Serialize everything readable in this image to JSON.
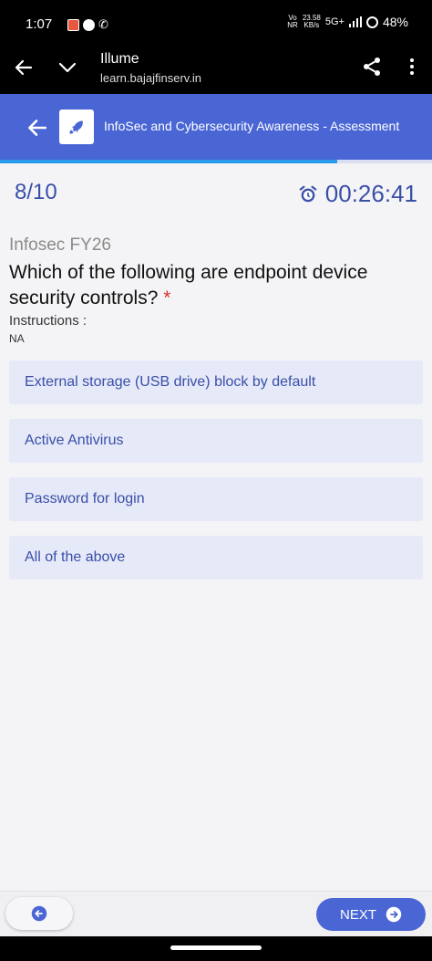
{
  "status": {
    "time": "1:07",
    "network_small_top": "Vo",
    "network_small_bottom": "NR",
    "speed_value": "23.58",
    "speed_unit": "KB/s",
    "network": "5G+",
    "battery": "48%"
  },
  "browser": {
    "title": "Illume",
    "url": "learn.bajajfinserv.in"
  },
  "app": {
    "title": "InfoSec and Cybersecurity Awareness - Assessment"
  },
  "progress": {
    "fraction": 0.78
  },
  "quiz": {
    "counter": "8/10",
    "timer": "00:26:41",
    "section": "Infosec FY26",
    "question": "Which of the following are endpoint device security controls?",
    "required_mark": "*",
    "instructions_label": "Instructions :",
    "instructions_value": "NA",
    "options": [
      "External storage (USB drive) block by default",
      "Active Antivirus",
      "Password for login",
      "All of the above"
    ]
  },
  "footer": {
    "next_label": "NEXT"
  },
  "colors": {
    "primary": "#4a66d4",
    "option_bg": "#e6e9f8",
    "accent_text": "#3a4fa8",
    "progress": "#2a9be8"
  }
}
